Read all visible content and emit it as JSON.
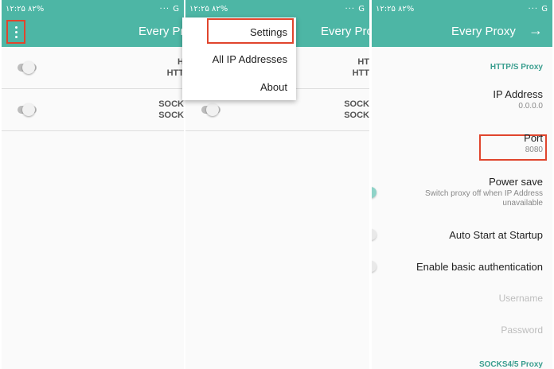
{
  "status": {
    "time": "۱۲:۲۵",
    "battery": "۸۲%",
    "icons_right": "··· G"
  },
  "app": {
    "title_clipped_1": "Every Prox",
    "title_clipped_2": "Every Prox",
    "title_full": "Every Proxy",
    "menu_icon": "more-vert-icon",
    "forward_icon": "arrow-right-icon"
  },
  "proxies": [
    {
      "line1": "H",
      "line2": "HTT"
    },
    {
      "line1": "SOCK",
      "line2": "SOCK"
    }
  ],
  "proxies_visible_2": [
    {
      "line1": "HT",
      "line2": "HTT"
    },
    {
      "line1": "SOCK",
      "line2": "SOCK"
    }
  ],
  "menu": {
    "settings": "Settings",
    "all_ip": "All IP Addresses",
    "about": "About"
  },
  "settings": {
    "http_header": "HTTP/S Proxy",
    "ip_title": "IP Address",
    "ip_value": "0.0.0.0",
    "port_title": "Port",
    "port_value": "8080",
    "power_title": "Power save",
    "power_summary_1": "Switch proxy off when IP Address",
    "power_summary_2": "unavailable",
    "autostart_title": "Auto Start at Startup",
    "auth_title": "Enable basic authentication",
    "username": "Username",
    "password": "Password",
    "socks_header": "SOCKS4/5 Proxy"
  },
  "colors": {
    "accent": "#4db6a5",
    "highlight": "#e0452d"
  }
}
